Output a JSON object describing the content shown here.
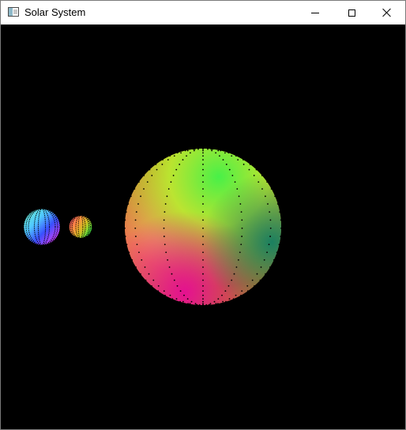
{
  "window": {
    "title": "Solar System",
    "app_icon": "window-app-icon",
    "controls": {
      "minimize_icon": "minimize-icon",
      "maximize_icon": "maximize-icon",
      "close_icon": "close-icon"
    }
  },
  "scene": {
    "background": "#000000",
    "bodies": [
      {
        "name": "sun",
        "colors": [
          "#b8ff40",
          "#30e840",
          "#ff8060",
          "#e0108c",
          "#a06000"
        ]
      },
      {
        "name": "planet-1",
        "colors": [
          "#60e0ff",
          "#3050ff",
          "#c040ff",
          "#ff40a0",
          "#40ffb0"
        ]
      },
      {
        "name": "planet-2",
        "colors": [
          "#ff4060",
          "#e0b020",
          "#60ff40",
          "#ff8040"
        ]
      }
    ]
  }
}
